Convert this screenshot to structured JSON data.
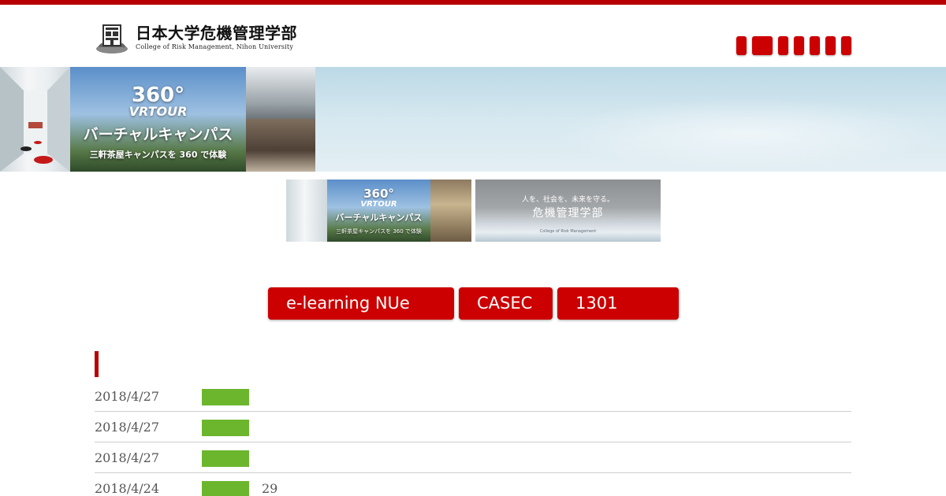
{
  "header": {
    "logo_title": "日本大学危機管理学部",
    "logo_subtitle": "College of Risk Management, Nihon University",
    "nav_items": [
      "",
      "",
      "",
      "",
      "",
      "",
      ""
    ]
  },
  "hero": {
    "badge": "360°",
    "tour_label": "VRTOUR",
    "title": "バーチャルキャンパス",
    "caption": "三軒茶屋キャンパスを 360 で体験"
  },
  "thumbnails": [
    {
      "badge": "360°",
      "tour_label": "VRTOUR",
      "title": "バーチャルキャンパス",
      "caption": "三軒茶屋キャンパスを 360 で体験"
    },
    {
      "tagline": "人を、社会を、未来を守る。",
      "title": "危機管理学部",
      "subtitle": "College of Risk Management"
    }
  ],
  "quick_links": [
    {
      "label": "e-learning NUe"
    },
    {
      "label": "CASEC"
    },
    {
      "label": "1301"
    }
  ],
  "news": [
    {
      "date": "2018/4/27",
      "tag": "",
      "text": ""
    },
    {
      "date": "2018/4/27",
      "tag": "",
      "text": ""
    },
    {
      "date": "2018/4/27",
      "tag": "",
      "text": ""
    },
    {
      "date": "2018/4/24",
      "tag": "",
      "text": "29"
    }
  ],
  "colors": {
    "brand_red": "#cc0000",
    "top_bar": "#b80000",
    "news_tag_green": "#6cb62e"
  }
}
